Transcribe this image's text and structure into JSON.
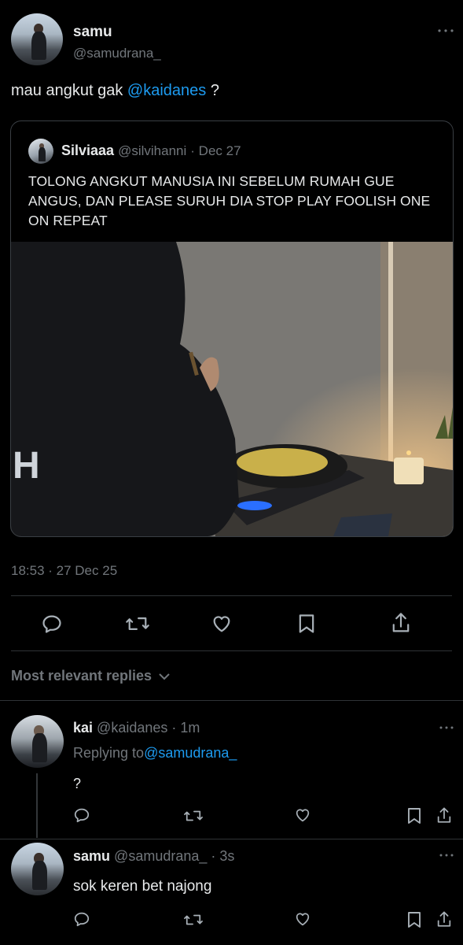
{
  "tweet": {
    "display_name": "samu",
    "handle": "@samudrana_",
    "text_prefix": "mau angkut gak",
    "mention": "@kaidanes",
    "text_suffix": "?",
    "timestamp": "18:53 · 27 Dec 25"
  },
  "quote": {
    "display_name": "Silviaaa",
    "handle": "@silvihanni",
    "date": "· Dec 27",
    "text": "TOLONG ANGKUT MANUSIA INI SEBELUM RUMAH GUE ANGUS, DAN PLEASE SURUH DIA STOP PLAY FOOLISH ONE ON REPEAT"
  },
  "replies_sort": "Most relevant replies",
  "replies": [
    {
      "display_name": "kai",
      "handle": "@kaidanes",
      "time": "· 1m",
      "replying_label": "Replying to",
      "replying_to": "@samudrana_",
      "text": "?"
    },
    {
      "display_name": "samu",
      "handle": "@samudrana_",
      "time": "· 3s",
      "text": "sok keren bet najong"
    }
  ],
  "icons": {
    "more": "more-icon",
    "reply": "reply-icon",
    "retweet": "retweet-icon",
    "like": "heart-icon",
    "bookmark": "bookmark-icon",
    "share": "share-icon",
    "chevron": "chevron-down-icon"
  },
  "colors": {
    "background": "#000000",
    "link": "#1d9bf0",
    "muted": "#71767b",
    "divider": "#2f3336"
  }
}
